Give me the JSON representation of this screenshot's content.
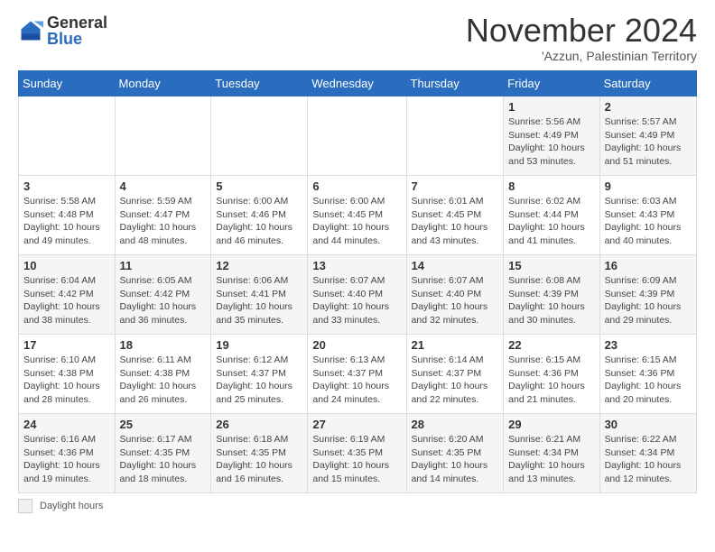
{
  "logo": {
    "general": "General",
    "blue": "Blue"
  },
  "header": {
    "month": "November 2024",
    "location": "'Azzun, Palestinian Territory"
  },
  "days_of_week": [
    "Sunday",
    "Monday",
    "Tuesday",
    "Wednesday",
    "Thursday",
    "Friday",
    "Saturday"
  ],
  "weeks": [
    [
      {
        "day": "",
        "info": ""
      },
      {
        "day": "",
        "info": ""
      },
      {
        "day": "",
        "info": ""
      },
      {
        "day": "",
        "info": ""
      },
      {
        "day": "",
        "info": ""
      },
      {
        "day": "1",
        "info": "Sunrise: 5:56 AM\nSunset: 4:49 PM\nDaylight: 10 hours\nand 53 minutes."
      },
      {
        "day": "2",
        "info": "Sunrise: 5:57 AM\nSunset: 4:49 PM\nDaylight: 10 hours\nand 51 minutes."
      }
    ],
    [
      {
        "day": "3",
        "info": "Sunrise: 5:58 AM\nSunset: 4:48 PM\nDaylight: 10 hours\nand 49 minutes."
      },
      {
        "day": "4",
        "info": "Sunrise: 5:59 AM\nSunset: 4:47 PM\nDaylight: 10 hours\nand 48 minutes."
      },
      {
        "day": "5",
        "info": "Sunrise: 6:00 AM\nSunset: 4:46 PM\nDaylight: 10 hours\nand 46 minutes."
      },
      {
        "day": "6",
        "info": "Sunrise: 6:00 AM\nSunset: 4:45 PM\nDaylight: 10 hours\nand 44 minutes."
      },
      {
        "day": "7",
        "info": "Sunrise: 6:01 AM\nSunset: 4:45 PM\nDaylight: 10 hours\nand 43 minutes."
      },
      {
        "day": "8",
        "info": "Sunrise: 6:02 AM\nSunset: 4:44 PM\nDaylight: 10 hours\nand 41 minutes."
      },
      {
        "day": "9",
        "info": "Sunrise: 6:03 AM\nSunset: 4:43 PM\nDaylight: 10 hours\nand 40 minutes."
      }
    ],
    [
      {
        "day": "10",
        "info": "Sunrise: 6:04 AM\nSunset: 4:42 PM\nDaylight: 10 hours\nand 38 minutes."
      },
      {
        "day": "11",
        "info": "Sunrise: 6:05 AM\nSunset: 4:42 PM\nDaylight: 10 hours\nand 36 minutes."
      },
      {
        "day": "12",
        "info": "Sunrise: 6:06 AM\nSunset: 4:41 PM\nDaylight: 10 hours\nand 35 minutes."
      },
      {
        "day": "13",
        "info": "Sunrise: 6:07 AM\nSunset: 4:40 PM\nDaylight: 10 hours\nand 33 minutes."
      },
      {
        "day": "14",
        "info": "Sunrise: 6:07 AM\nSunset: 4:40 PM\nDaylight: 10 hours\nand 32 minutes."
      },
      {
        "day": "15",
        "info": "Sunrise: 6:08 AM\nSunset: 4:39 PM\nDaylight: 10 hours\nand 30 minutes."
      },
      {
        "day": "16",
        "info": "Sunrise: 6:09 AM\nSunset: 4:39 PM\nDaylight: 10 hours\nand 29 minutes."
      }
    ],
    [
      {
        "day": "17",
        "info": "Sunrise: 6:10 AM\nSunset: 4:38 PM\nDaylight: 10 hours\nand 28 minutes."
      },
      {
        "day": "18",
        "info": "Sunrise: 6:11 AM\nSunset: 4:38 PM\nDaylight: 10 hours\nand 26 minutes."
      },
      {
        "day": "19",
        "info": "Sunrise: 6:12 AM\nSunset: 4:37 PM\nDaylight: 10 hours\nand 25 minutes."
      },
      {
        "day": "20",
        "info": "Sunrise: 6:13 AM\nSunset: 4:37 PM\nDaylight: 10 hours\nand 24 minutes."
      },
      {
        "day": "21",
        "info": "Sunrise: 6:14 AM\nSunset: 4:37 PM\nDaylight: 10 hours\nand 22 minutes."
      },
      {
        "day": "22",
        "info": "Sunrise: 6:15 AM\nSunset: 4:36 PM\nDaylight: 10 hours\nand 21 minutes."
      },
      {
        "day": "23",
        "info": "Sunrise: 6:15 AM\nSunset: 4:36 PM\nDaylight: 10 hours\nand 20 minutes."
      }
    ],
    [
      {
        "day": "24",
        "info": "Sunrise: 6:16 AM\nSunset: 4:36 PM\nDaylight: 10 hours\nand 19 minutes."
      },
      {
        "day": "25",
        "info": "Sunrise: 6:17 AM\nSunset: 4:35 PM\nDaylight: 10 hours\nand 18 minutes."
      },
      {
        "day": "26",
        "info": "Sunrise: 6:18 AM\nSunset: 4:35 PM\nDaylight: 10 hours\nand 16 minutes."
      },
      {
        "day": "27",
        "info": "Sunrise: 6:19 AM\nSunset: 4:35 PM\nDaylight: 10 hours\nand 15 minutes."
      },
      {
        "day": "28",
        "info": "Sunrise: 6:20 AM\nSunset: 4:35 PM\nDaylight: 10 hours\nand 14 minutes."
      },
      {
        "day": "29",
        "info": "Sunrise: 6:21 AM\nSunset: 4:34 PM\nDaylight: 10 hours\nand 13 minutes."
      },
      {
        "day": "30",
        "info": "Sunrise: 6:22 AM\nSunset: 4:34 PM\nDaylight: 10 hours\nand 12 minutes."
      }
    ]
  ],
  "footer": {
    "legend_label": "Daylight hours"
  }
}
